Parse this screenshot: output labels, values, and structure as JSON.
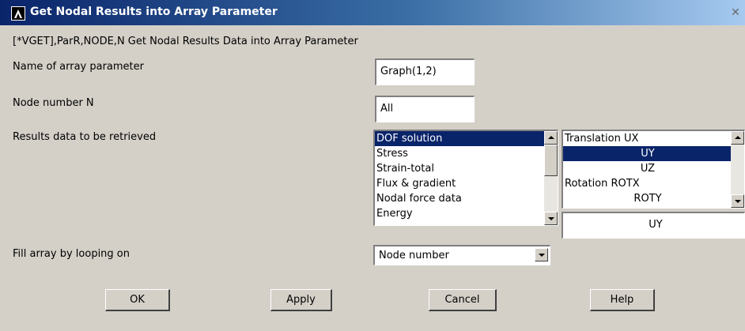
{
  "dialog": {
    "title": "Get Nodal Results into Array Parameter",
    "close_symbol": "✕",
    "command_line": "[*VGET],ParR,NODE,N  Get Nodal Results Data into Array Parameter"
  },
  "fields": {
    "array_name": {
      "label": "Name of array parameter",
      "value": "Graph(1,2)"
    },
    "node_number": {
      "label": "Node number N",
      "value": "All"
    },
    "results": {
      "label": "Results data to be retrieved"
    },
    "fill_array": {
      "label": "Fill array by looping on",
      "value": "Node number"
    }
  },
  "results_list": {
    "items": [
      "DOF solution",
      "Stress",
      "Strain-total",
      "Flux & gradient",
      "Nodal force data",
      "Energy"
    ],
    "selected_index": 0
  },
  "component_list": {
    "items": [
      "Translation  UX",
      "UY",
      "UZ",
      "Rotation   ROTX",
      "ROTY"
    ],
    "selected_index": 1,
    "current_value": "UY"
  },
  "buttons": {
    "ok": "OK",
    "apply": "Apply",
    "cancel": "Cancel",
    "help": "Help"
  },
  "colors": {
    "dialog_bg": "#d4d0c8",
    "selection": "#0a246a",
    "title_start": "#0a246a",
    "title_end": "#a6caf0"
  }
}
